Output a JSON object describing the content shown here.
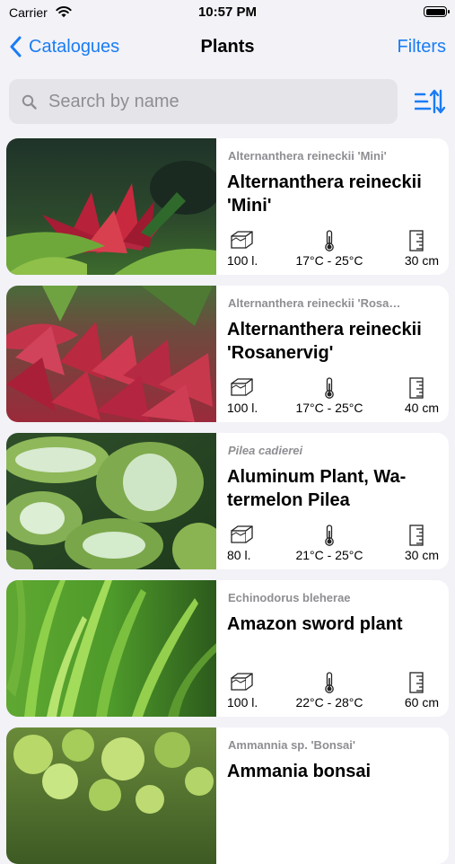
{
  "status_bar": {
    "carrier": "Carrier",
    "time": "10:57 PM"
  },
  "nav": {
    "back_label": "Catalogues",
    "title": "Plants",
    "filters_label": "Filters"
  },
  "search": {
    "placeholder": "Search by name"
  },
  "plants": [
    {
      "scientific": "Alternanthera reineckii 'Mini'",
      "common": "Alternanthera reineckii 'Mini'",
      "volume": "100 l.",
      "temperature": "17°C - 25°C",
      "size": "30 cm",
      "scientific_italic": false
    },
    {
      "scientific": "Alternanthera reineckii 'Rosa…",
      "common": "Alternanthera reineckii 'Rosanervig'",
      "volume": "100 l.",
      "temperature": "17°C - 25°C",
      "size": "40 cm",
      "scientific_italic": false
    },
    {
      "scientific": "Pilea cadierei",
      "common": "Aluminum Plant, Wa-termelon Pilea",
      "volume": "80 l.",
      "temperature": "21°C - 25°C",
      "size": "30 cm",
      "scientific_italic": true
    },
    {
      "scientific": "Echinodorus bleherae",
      "common": "Amazon sword plant",
      "volume": "100 l.",
      "temperature": "22°C - 28°C",
      "size": "60 cm",
      "scientific_italic": false
    },
    {
      "scientific": "Ammannia sp. 'Bonsai'",
      "common": "Ammania bonsai",
      "volume": "",
      "temperature": "",
      "size": "",
      "scientific_italic": false
    }
  ],
  "colors": {
    "accent": "#1a7cf5",
    "background": "#f2f2f7",
    "secondary_text": "#8e8e93"
  },
  "icons": {
    "back": "chevron-left-icon",
    "search": "magnifier-icon",
    "sort": "sort-arrows-icon",
    "volume": "tank-icon",
    "temperature": "thermometer-icon",
    "size": "ruler-icon"
  }
}
